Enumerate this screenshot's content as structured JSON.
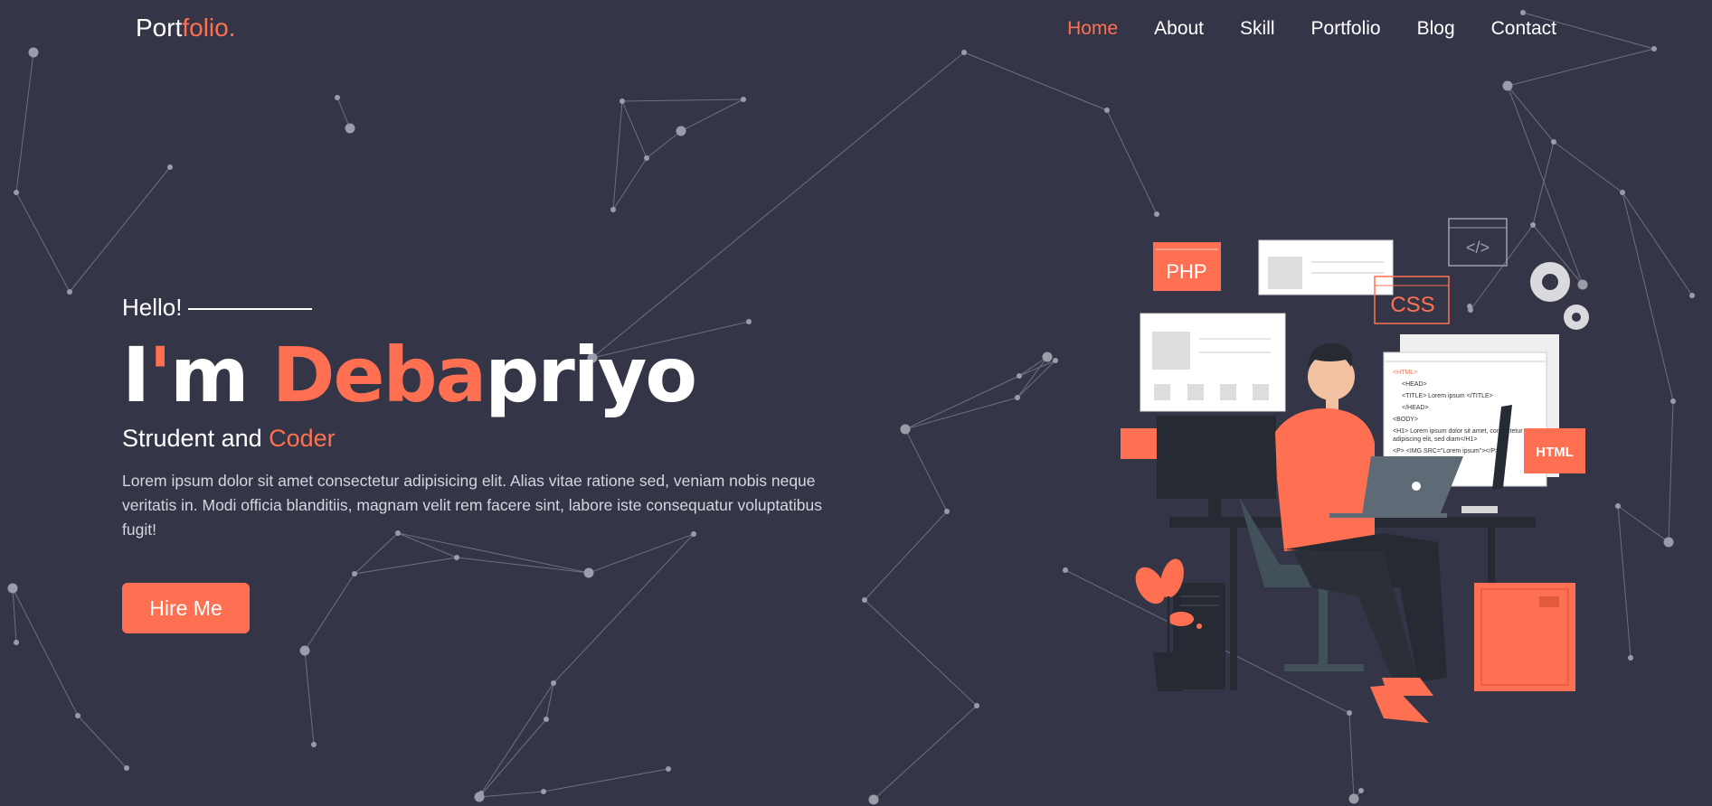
{
  "brand": {
    "logo_part1": "Port",
    "logo_part2": "folio."
  },
  "nav": {
    "items": [
      "Home",
      "About",
      "Skill",
      "Portfolio",
      "Blog",
      "Contact"
    ],
    "active": "Home"
  },
  "hero": {
    "greeting": "Hello!",
    "headline": {
      "prefix_i": "I",
      "apostrophe": "'",
      "prefix_m": "m ",
      "name_accent": "Deba",
      "name_rest": "priyo"
    },
    "subtitle": {
      "plain": "Strudent and ",
      "accent": "Coder"
    },
    "description": "Lorem ipsum dolor sit amet consectetur adipisicing elit. Alias vitae ratione sed, veniam nobis neque veritatis in. Modi officia blanditiis, magnam velit rem facere sint, labore iste consequatur voluptatibus fugit!",
    "cta_label": "Hire Me"
  },
  "illustration": {
    "php_label": "PHP",
    "css_label": "CSS",
    "html_label": "HTML",
    "code_icon": "</>",
    "code_lines": [
      "<HTML>",
      "<HEAD>",
      "<TITLE> Lorem ipsum </TITLE>",
      "</HEAD>",
      "<BODY>",
      "<H1> Lorem ipsum dolor sit amet, consectetur",
      "adipiscing elit, sed diam</H1>",
      "<P> <IMG SRC=\"Lorem ipsum\"></P>"
    ]
  },
  "colors": {
    "background": "#343647",
    "accent": "#ff7052",
    "text": "#ffffff"
  }
}
